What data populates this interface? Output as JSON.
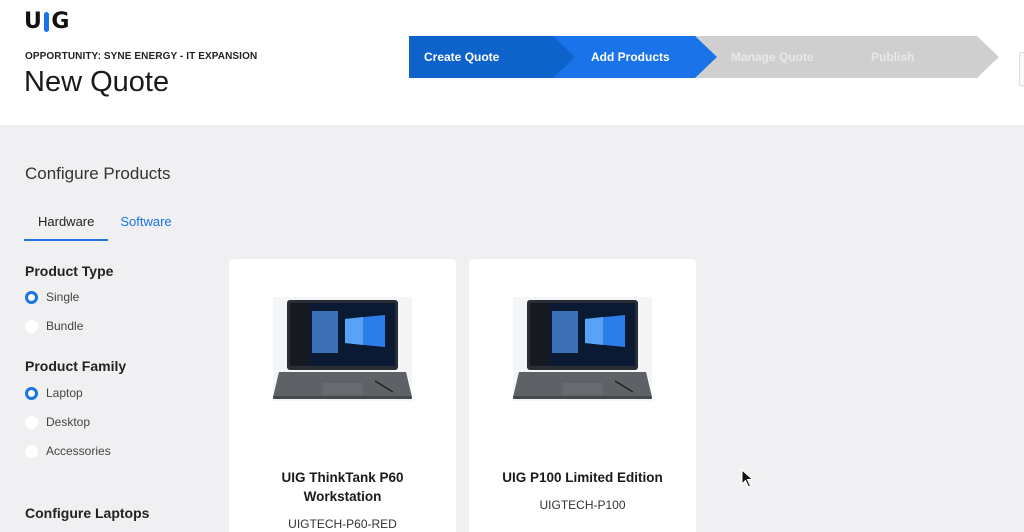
{
  "header": {
    "logo_left": "U",
    "logo_right": "G",
    "opportunity": "OPPORTUNITY: SYNE ENERGY - IT EXPANSION",
    "title": "New Quote"
  },
  "steps": [
    {
      "label": "Create Quote",
      "state": "complete",
      "color": "#0d63c9"
    },
    {
      "label": "Add Products",
      "state": "current",
      "color": "#1a73e8"
    },
    {
      "label": "Manage Quote",
      "state": "pending",
      "color": "#cfcfcf"
    },
    {
      "label": "Publish",
      "state": "pending",
      "color": "#cfcfcf"
    }
  ],
  "configure": {
    "title": "Configure Products",
    "tabs": [
      {
        "label": "Hardware",
        "active": true
      },
      {
        "label": "Software",
        "active": false
      }
    ],
    "product_type": {
      "title": "Product Type",
      "options": [
        {
          "label": "Single",
          "selected": true
        },
        {
          "label": "Bundle",
          "selected": false
        }
      ]
    },
    "product_family": {
      "title": "Product Family",
      "options": [
        {
          "label": "Laptop",
          "selected": true
        },
        {
          "label": "Desktop",
          "selected": false
        },
        {
          "label": "Accessories",
          "selected": false
        }
      ]
    },
    "configure_laptops_title": "Configure Laptops"
  },
  "products": [
    {
      "name_line1": "UIG ThinkTank P60",
      "name_line2": "Workstation",
      "sku": "UIGTECH-P60-RED",
      "image": "laptop-image"
    },
    {
      "name_line1": "UIG P100 Limited Edition",
      "name_line2": "",
      "sku": "UIGTECH-P100",
      "image": "laptop-image"
    }
  ],
  "colors": {
    "accent": "#1a73e8",
    "background": "#f0f0f2"
  }
}
